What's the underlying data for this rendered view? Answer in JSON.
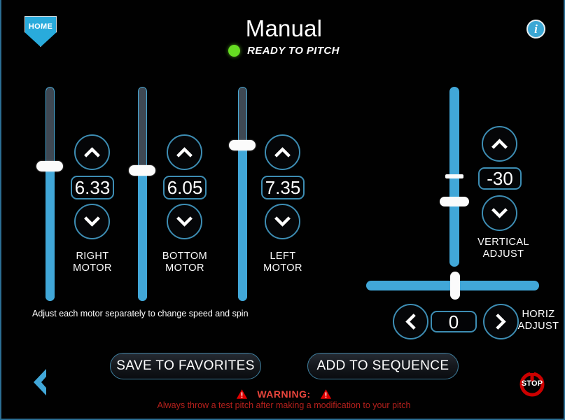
{
  "header": {
    "home_label": "HOME",
    "title": "Manual",
    "status_text": "READY TO PITCH",
    "status_color": "#66DD22",
    "info_glyph": "i"
  },
  "accent_color": "#41A7D8",
  "motors": [
    {
      "name": "right",
      "value": "6.33",
      "label_line1": "RIGHT",
      "label_line2": "MOTOR"
    },
    {
      "name": "bottom",
      "value": "6.05",
      "label_line1": "BOTTOM",
      "label_line2": "MOTOR"
    },
    {
      "name": "left",
      "value": "7.35",
      "label_line1": "LEFT",
      "label_line2": "MOTOR"
    }
  ],
  "helper_text": "Adjust each motor separately to change speed and spin",
  "vertical_adjust": {
    "value": "-30",
    "label_line1": "VERTICAL",
    "label_line2": "ADJUST"
  },
  "horizontal_adjust": {
    "value": "0",
    "label_line1": "HORIZ",
    "label_line2": "ADJUST"
  },
  "actions": {
    "save_label": "SAVE TO FAVORITES",
    "add_label": "ADD TO SEQUENCE",
    "stop_label": "STOP"
  },
  "warning": {
    "title": "WARNING:",
    "message": "Always throw a test pitch after making a modification to your pitch",
    "color": "#b5201c"
  }
}
